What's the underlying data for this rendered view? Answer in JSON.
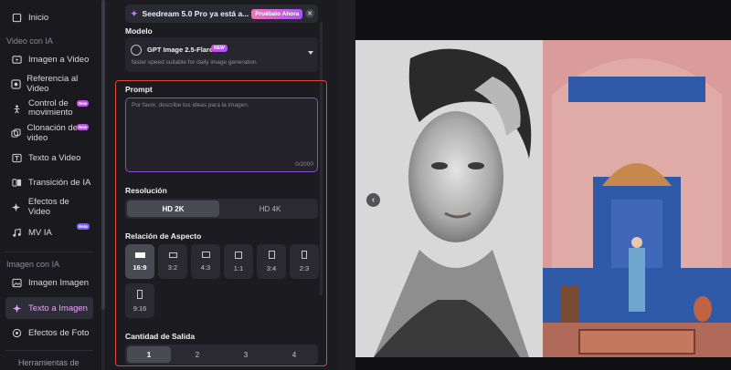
{
  "sidebar": {
    "home": "Inicio",
    "section_video": "Video con IA",
    "video_items": [
      {
        "label": "Imagen a Video",
        "icon": "image-video-icon"
      },
      {
        "label": "Referencia al Video",
        "icon": "reference-icon"
      },
      {
        "label": "Control de movimiento",
        "icon": "motion-icon",
        "badge": "New"
      },
      {
        "label": "Clonación de video",
        "icon": "clone-icon",
        "badge": "New"
      },
      {
        "label": "Texto a Video",
        "icon": "text-video-icon"
      },
      {
        "label": "Transición de IA",
        "icon": "transition-icon"
      },
      {
        "label": "Efectos de Video",
        "icon": "effects-icon"
      },
      {
        "label": "MV IA",
        "icon": "music-video-icon",
        "badge": "Beta"
      }
    ],
    "section_image": "Imagen con IA",
    "image_items": [
      {
        "label": "Imagen Imagen",
        "icon": "image-image-icon"
      },
      {
        "label": "Texto a Imagen",
        "icon": "text-image-icon",
        "active": true
      },
      {
        "label": "Efectos de Foto",
        "icon": "photo-effects-icon"
      }
    ],
    "section_tools": "Herramientas de"
  },
  "banner": {
    "text": "Seedream 5.0 Pro ya está a...",
    "cta": "Pruébalo Ahora"
  },
  "model": {
    "label": "Modelo",
    "name": "GPT Image 2.5-Flare",
    "badge": "NEW",
    "description": "faster speed suitable for daily image generation"
  },
  "prompt": {
    "label": "Prompt",
    "placeholder": "Por favor, describe tus ideas para la imagen.",
    "counter": "0/2000"
  },
  "resolution": {
    "label": "Resolución",
    "options": [
      "HD 2K",
      "HD 4K"
    ],
    "selected": "HD 2K"
  },
  "aspect_ratio": {
    "label": "Relación de Aspecto",
    "options": [
      "16:9",
      "3:2",
      "4:3",
      "1:1",
      "3:4",
      "2:3",
      "9:16"
    ],
    "selected": "16:9"
  },
  "quantity": {
    "label": "Cantidad de Salida",
    "options": [
      "1",
      "2",
      "3",
      "4"
    ],
    "selected": "1"
  },
  "colors": {
    "accent": "#a855f7",
    "highlight_frame": "#e2453c",
    "active_sidebar_text": "#e7a6ff"
  }
}
